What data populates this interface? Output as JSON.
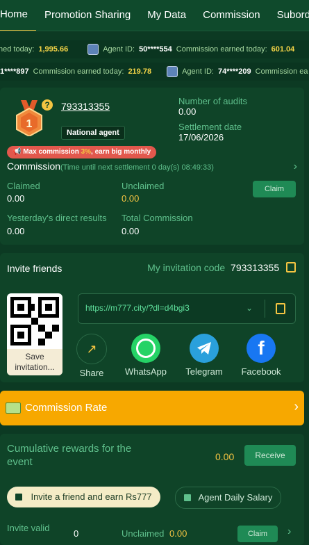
{
  "tabs": [
    "Home",
    "Promotion Sharing",
    "My Data",
    "Commission",
    "Subordinate"
  ],
  "ticker1": [
    {
      "prefix": "ned today:",
      "value": "1,995.66"
    },
    {
      "id_label": "Agent ID:",
      "id": "50****554",
      "earned_label": "Commission earned today:",
      "earned": "601.04"
    }
  ],
  "ticker2": [
    {
      "id": "1****897",
      "earned_label": "Commission earned today:",
      "earned": "219.78"
    },
    {
      "id_label": "Agent ID:",
      "id": "74****209",
      "earned_label": "Commission ea"
    }
  ],
  "profile": {
    "level": "1",
    "user_id": "793313355",
    "rank": "National agent",
    "audits_label": "Number of audits",
    "audits": "0.00",
    "settlement_label": "Settlement date",
    "settlement": "17/06/2026",
    "max_banner_a": "Max commission ",
    "max_banner_pct": "3%",
    "max_banner_b": ", earn big monthly"
  },
  "commission": {
    "title": "Commission",
    "timer": "(Time until next settlement  0 day(s) 08:49:33)",
    "claimed_label": "Claimed",
    "claimed": "0.00",
    "unclaimed_label": "Unclaimed",
    "unclaimed": "0.00",
    "claim_btn": "Claim",
    "yesterday_label": "Yesterday's direct results",
    "yesterday": "0.00",
    "total_label": "Total Commission",
    "total": "0.00"
  },
  "invite": {
    "title": "Invite friends",
    "code_label": "My invitation code",
    "code": "793313355",
    "link": "https://m777.city/?dl=d4bgi3",
    "save": "Save invitation...",
    "share_items": [
      {
        "label": "Share",
        "icon": "share-icon",
        "color": "#0f4428"
      },
      {
        "label": "WhatsApp",
        "icon": "whatsapp-icon",
        "color": "#25d366"
      },
      {
        "label": "Telegram",
        "icon": "telegram-icon",
        "color": "#2aa0dc"
      },
      {
        "label": "Facebook",
        "icon": "facebook-icon",
        "color": "#1877f2"
      }
    ]
  },
  "rate": {
    "label": "Commission Rate"
  },
  "event": {
    "title": "Cumulative rewards for the event",
    "value": "0.00",
    "btn": "Receive",
    "pill1": "Invite a friend and earn Rs777",
    "pill2": "Agent Daily Salary",
    "valid_label": "Invite valid",
    "valid_value": "0",
    "unclaimed_label": "Unclaimed",
    "unclaimed_value": "0.00",
    "claim_btn": "Claim"
  }
}
